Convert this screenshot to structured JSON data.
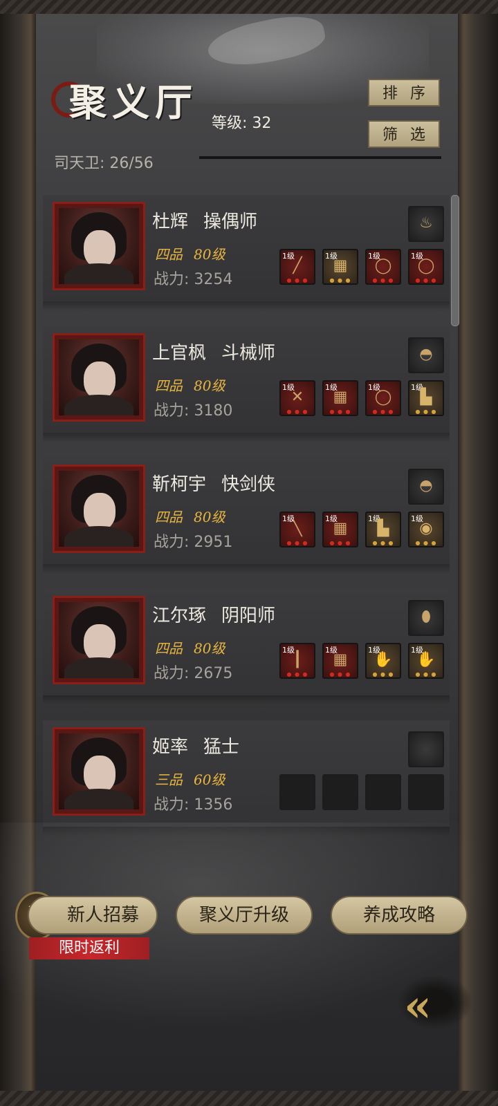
{
  "header": {
    "title": "聚义厅",
    "level_label": "等级:",
    "level_value": "32",
    "guards": "司天卫: 26/56",
    "sort_label": "排序",
    "filter_label": "筛选"
  },
  "characters": [
    {
      "name": "杜辉",
      "class": "操偶师",
      "rank": "四品",
      "level": "80级",
      "power_label": "战力:",
      "power": "3254",
      "top_item": "lamp-icon",
      "equipment": [
        {
          "level": "1级",
          "icon": "spear-icon",
          "tier": "red"
        },
        {
          "level": "1级",
          "icon": "armor-icon",
          "tier": "brown"
        },
        {
          "level": "1级",
          "icon": "ring-icon",
          "tier": "red"
        },
        {
          "level": "1级",
          "icon": "ring-icon",
          "tier": "red"
        }
      ]
    },
    {
      "name": "上官枫",
      "class": "斗械师",
      "rank": "四品",
      "level": "80级",
      "power_label": "战力:",
      "power": "3180",
      "top_item": "gauntlet-icon",
      "equipment": [
        {
          "level": "1级",
          "icon": "crossbow-icon",
          "tier": "red"
        },
        {
          "level": "1级",
          "icon": "armor-icon",
          "tier": "red"
        },
        {
          "level": "1级",
          "icon": "ring-icon",
          "tier": "red"
        },
        {
          "level": "1级",
          "icon": "boots-icon",
          "tier": "brown"
        }
      ]
    },
    {
      "name": "靳柯宇",
      "class": "快剑侠",
      "rank": "四品",
      "level": "80级",
      "power_label": "战力:",
      "power": "2951",
      "top_item": "gauntlet-icon",
      "equipment": [
        {
          "level": "1级",
          "icon": "sword-icon",
          "tier": "red"
        },
        {
          "level": "1级",
          "icon": "armor-icon",
          "tier": "red"
        },
        {
          "level": "1级",
          "icon": "boots-icon",
          "tier": "brown"
        },
        {
          "level": "1级",
          "icon": "pendant-icon",
          "tier": "brown"
        }
      ]
    },
    {
      "name": "江尔琢",
      "class": "阴阳师",
      "rank": "四品",
      "level": "80级",
      "power_label": "战力:",
      "power": "2675",
      "top_item": "gem-icon",
      "equipment": [
        {
          "level": "1级",
          "icon": "staff-icon",
          "tier": "red"
        },
        {
          "level": "1级",
          "icon": "armor-icon",
          "tier": "red"
        },
        {
          "level": "1级",
          "icon": "glove-icon",
          "tier": "brown"
        },
        {
          "level": "1级",
          "icon": "glove-icon",
          "tier": "brown"
        }
      ]
    },
    {
      "name": "姬率",
      "class": "猛士",
      "rank": "三品",
      "level": "60级",
      "power_label": "战力:",
      "power": "1356",
      "top_item": "empty-slot-icon",
      "equipment": [
        {
          "level": "",
          "icon": "empty-slot-icon",
          "tier": "dark"
        },
        {
          "level": "",
          "icon": "empty-slot-icon",
          "tier": "dark"
        },
        {
          "level": "",
          "icon": "empty-slot-icon",
          "tier": "dark"
        },
        {
          "level": "",
          "icon": "empty-slot-icon",
          "tier": "dark"
        }
      ]
    }
  ],
  "footer": {
    "recruit_label": "新人招募",
    "recruit_icon": "弑",
    "promo_label": "限时返利",
    "upgrade_label": "聚义厅升级",
    "guide_label": "养成攻略"
  },
  "colors": {
    "rank_gold": "#e8b640",
    "frame_red": "#8a1e18",
    "button_tan": "#c4b690",
    "promo_red": "#c6272b"
  }
}
